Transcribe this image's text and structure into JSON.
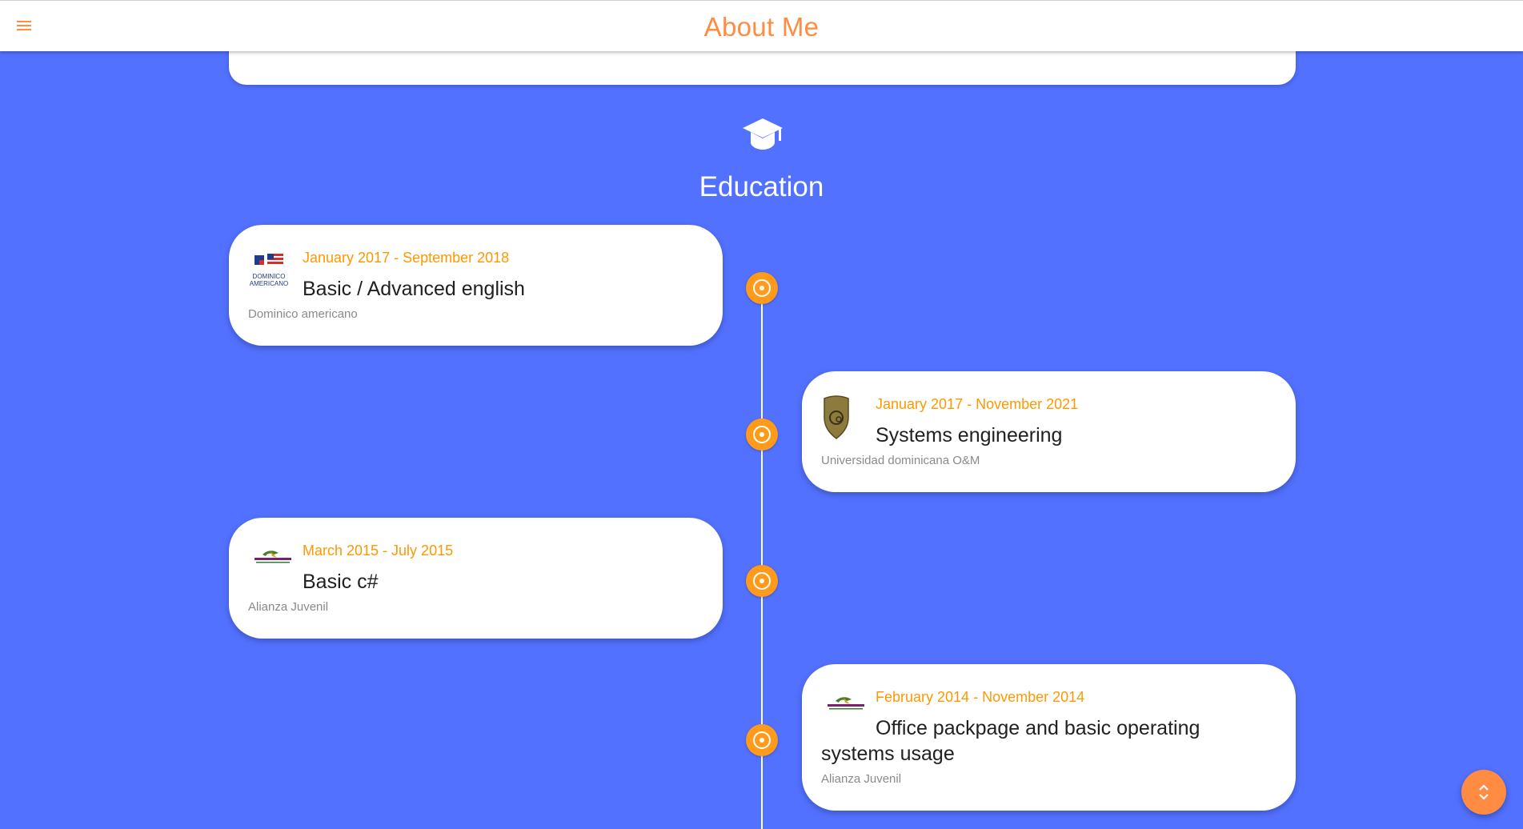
{
  "header": {
    "title": "About Me",
    "menu_icon": "hamburger-menu-icon"
  },
  "section": {
    "title": "Education",
    "icon": "graduation-cap-icon"
  },
  "education": [
    {
      "date": "January 2017 - September 2018",
      "course": "Basic / Advanced english",
      "school": "Dominico americano",
      "logo": "dominico-americano-logo",
      "side": "left"
    },
    {
      "date": "January 2017 - November 2021",
      "course": "Systems engineering",
      "school": "Universidad dominicana O&M",
      "logo": "o-and-m-shield-logo",
      "side": "right"
    },
    {
      "date": "March 2015 - July 2015",
      "course": "Basic c#",
      "school": "Alianza Juvenil",
      "logo": "alianza-juvenil-logo",
      "side": "left"
    },
    {
      "date": "February 2014 - November 2014",
      "course": "Office packpage and basic operating systems usage",
      "school": "Alianza Juvenil",
      "logo": "alianza-juvenil-logo",
      "side": "right"
    }
  ],
  "fab": {
    "icon": "scroll-up-down-icon"
  },
  "colors": {
    "background": "#5271ff",
    "accent": "#ff8c42",
    "date": "#ff9800",
    "timeline_dot": "#ff9a1a"
  }
}
